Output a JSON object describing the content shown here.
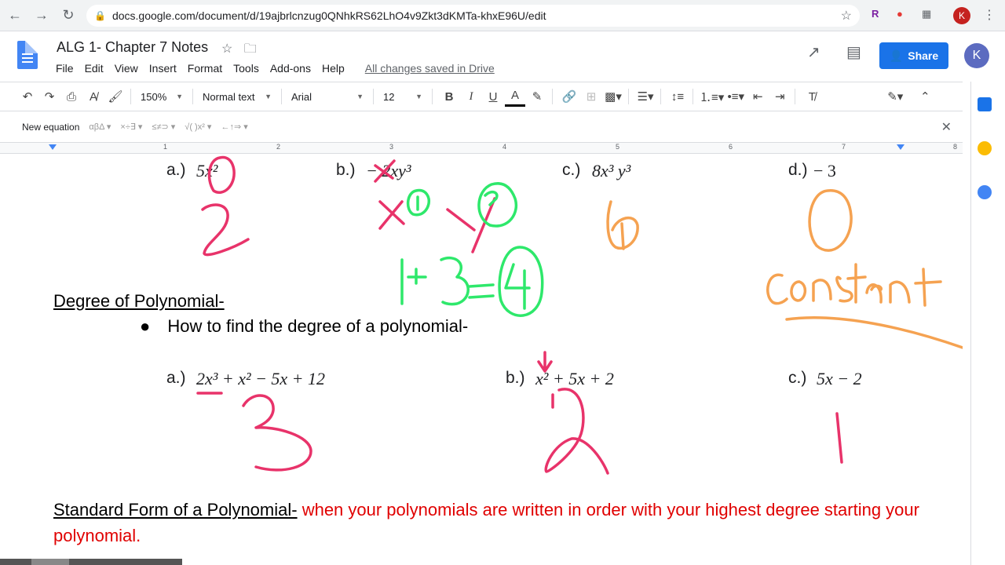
{
  "browser": {
    "url": "docs.google.com/document/d/19ajbrlcnzug0QNhkRS62LhO4v9Zkt3dKMTa-khxE96U/edit",
    "profile_initial": "K"
  },
  "header": {
    "doc_title": "ALG 1- Chapter 7 Notes",
    "menu": [
      "File",
      "Edit",
      "View",
      "Insert",
      "Format",
      "Tools",
      "Add-ons",
      "Help"
    ],
    "saved_status": "All changes saved in Drive",
    "share_label": "Share",
    "avatar_initial": "K"
  },
  "toolbar": {
    "zoom": "150%",
    "style": "Normal text",
    "font": "Arial",
    "size": "12"
  },
  "equation_bar": {
    "new_equation_label": "New equation",
    "groups": [
      "αβΔ ▾",
      "×÷∃ ▾",
      "≤≠⊃ ▾",
      "√( )x² ▾",
      "←↑⇒ ▾"
    ]
  },
  "ruler": {
    "ticks": [
      "1",
      "2",
      "3",
      "4",
      "5",
      "6",
      "7",
      "8"
    ]
  },
  "document": {
    "row1": [
      {
        "label": "a.)",
        "expr": "5x²"
      },
      {
        "label": "b.)",
        "expr": "− 2xy³"
      },
      {
        "label": "c.)",
        "expr": "8x³ y³"
      },
      {
        "label": "d.)",
        "expr": "− 3"
      }
    ],
    "degree_heading": "Degree of Polynomial-",
    "bullet_text": "How to find the degree of a polynomial-",
    "row2": [
      {
        "label": "a.)",
        "expr": "2x³ + x² − 5x + 12"
      },
      {
        "label": "b.)",
        "expr": "x² + 5x + 2"
      },
      {
        "label": "c.)",
        "expr": "5x − 2"
      }
    ],
    "standard_form_heading": "Standard Form of a Polynomial-",
    "standard_form_text": " when your polynomials are written in order with your highest degree starting your polynomial."
  },
  "colors": {
    "pink_ink": "#e8336a",
    "green_ink": "#2ee86b",
    "orange_ink": "#f5a251",
    "share_blue": "#1a73e8",
    "definition_red": "#e00000"
  }
}
